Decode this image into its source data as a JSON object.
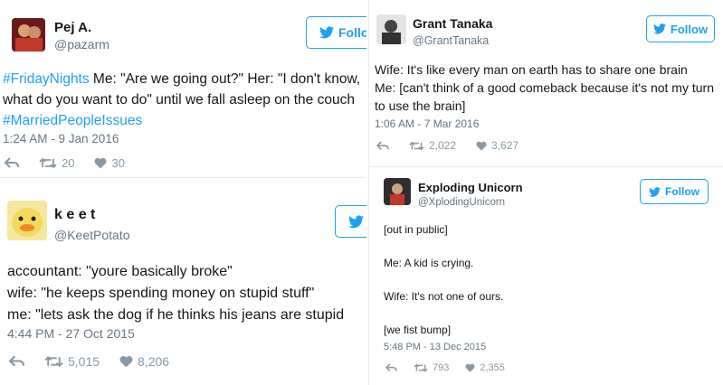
{
  "colors": {
    "accent": "#1da1f2",
    "muted": "#657786",
    "action": "#8899a6"
  },
  "tweets": [
    {
      "name": "Pej A.",
      "handle": "@pazarm",
      "follow_label": "Follo",
      "text_hashtag1": "#FridayNights",
      "text_body": " Me: \"Are we going out?\" Her: \"I don't know, what do you want to do\" until we fall asleep on the couch",
      "text_hashtag2": "#MarriedPeopleIssues",
      "time": "1:24 AM - 9 Jan 2016",
      "retweets": "20",
      "likes": "30"
    },
    {
      "name": "k e e t",
      "handle": "@KeetPotato",
      "follow_label": "",
      "text": "accountant: \"youre basically broke\"\nwife: \"he keeps spending money on stupid stuff\"\nme: \"lets ask the dog if he thinks his jeans are stupid",
      "time": "4:44 PM - 27 Oct 2015",
      "retweets": "5,015",
      "likes": "8,206"
    },
    {
      "name": "Grant Tanaka",
      "handle": "@GrantTanaka",
      "follow_label": "Follow",
      "text": "Wife: It's like every man on earth has to share one brain\nMe: [can't think of a good comeback because it's not my turn to use the brain]",
      "time": "1:06 AM - 7 Mar 2016",
      "retweets": "2,022",
      "likes": "3,627"
    },
    {
      "name": "Exploding Unicorn",
      "handle": "@XplodingUnicorn",
      "follow_label": "Follow",
      "line1": "[out in public]",
      "line2": "Me: A kid is crying.",
      "line3": "Wife: It's not one of ours.",
      "line4": "[we fist bump]",
      "time": "5:48 PM - 13 Dec 2015",
      "retweets": "793",
      "likes": "2,355"
    }
  ]
}
